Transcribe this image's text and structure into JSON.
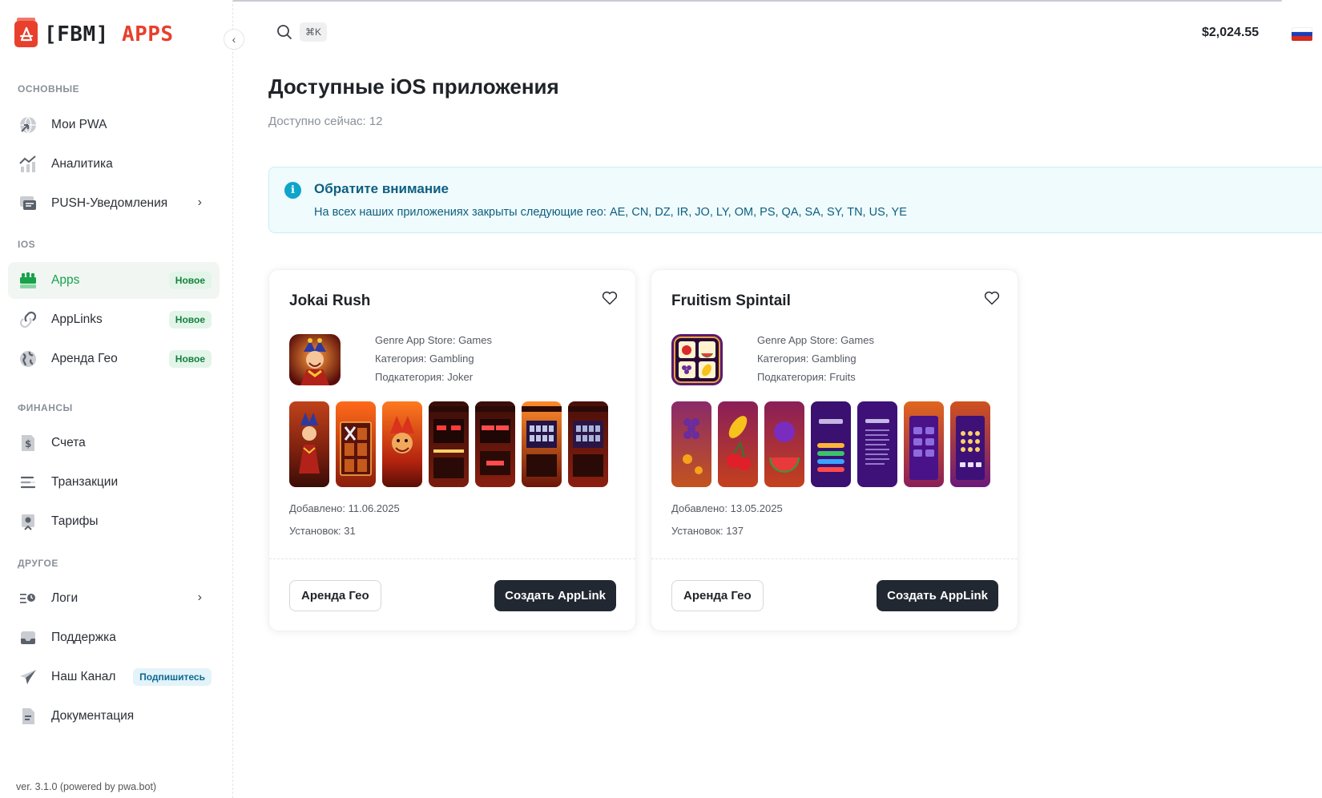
{
  "brand": {
    "logo_bracket": "[FBM]",
    "logo_apps": "APPS"
  },
  "sidebar": {
    "sections": [
      {
        "title": "ОСНОВНЫЕ"
      },
      {
        "title": "IOS"
      },
      {
        "title": "ФИНАНСЫ"
      },
      {
        "title": "ДРУГОЕ"
      }
    ],
    "items": [
      {
        "label": "Мои PWA",
        "icon": "globe-arrow-icon"
      },
      {
        "label": "Аналитика",
        "icon": "chart-icon"
      },
      {
        "label": "PUSH-Уведомления",
        "icon": "message-icon"
      },
      {
        "label": "Apps",
        "icon": "apps-store-icon",
        "badge": "Новое"
      },
      {
        "label": "AppLinks",
        "icon": "link-icon",
        "badge": "Новое"
      },
      {
        "label": "Аренда Гео",
        "icon": "earth-icon",
        "badge": "Новое"
      },
      {
        "label": "Счета",
        "icon": "invoice-icon"
      },
      {
        "label": "Транзакции",
        "icon": "lines-icon"
      },
      {
        "label": "Тарифы",
        "icon": "tariff-icon"
      },
      {
        "label": "Логи",
        "icon": "logs-icon"
      },
      {
        "label": "Поддержка",
        "icon": "inbox-icon"
      },
      {
        "label": "Наш Канал",
        "icon": "telegram-icon",
        "badge": "Подпишитесь"
      },
      {
        "label": "Документация",
        "icon": "document-icon"
      }
    ],
    "version": "ver. 3.1.0 (powered by pwa.bot)"
  },
  "header": {
    "shortcut": "⌘K",
    "balance": "$2,024.55"
  },
  "main": {
    "title": "Доступные iOS приложения",
    "subtitle": "Доступно сейчас: 12",
    "notice": {
      "title": "Обратите внимание",
      "text": "На всех наших приложениях закрыты следующие гео: AE, CN, DZ, IR, JO, LY, OM, PS, QA, SA, SY, TN, US, YE"
    },
    "cards": [
      {
        "name": "Jokai Rush",
        "genre": "Genre App Store: Games",
        "category": "Категория: Gambling",
        "subcategory": "Подкатегория: Joker",
        "added": "Добавлено: 11.06.2025",
        "installs": "Установок: 31",
        "btn_geo": "Аренда Гео",
        "btn_create": "Создать AppLink"
      },
      {
        "name": "Fruitism Spintail",
        "genre": "Genre App Store: Games",
        "category": "Категория: Gambling",
        "subcategory": "Подкатегория: Fruits",
        "added": "Добавлено: 13.05.2025",
        "installs": "Установок: 137",
        "btn_geo": "Аренда Гео",
        "btn_create": "Создать AppLink"
      }
    ]
  },
  "colors": {
    "accent_green": "#16a34a",
    "brand_red": "#e8402c",
    "info": "#0ea5c9",
    "dark_button": "#222831"
  }
}
